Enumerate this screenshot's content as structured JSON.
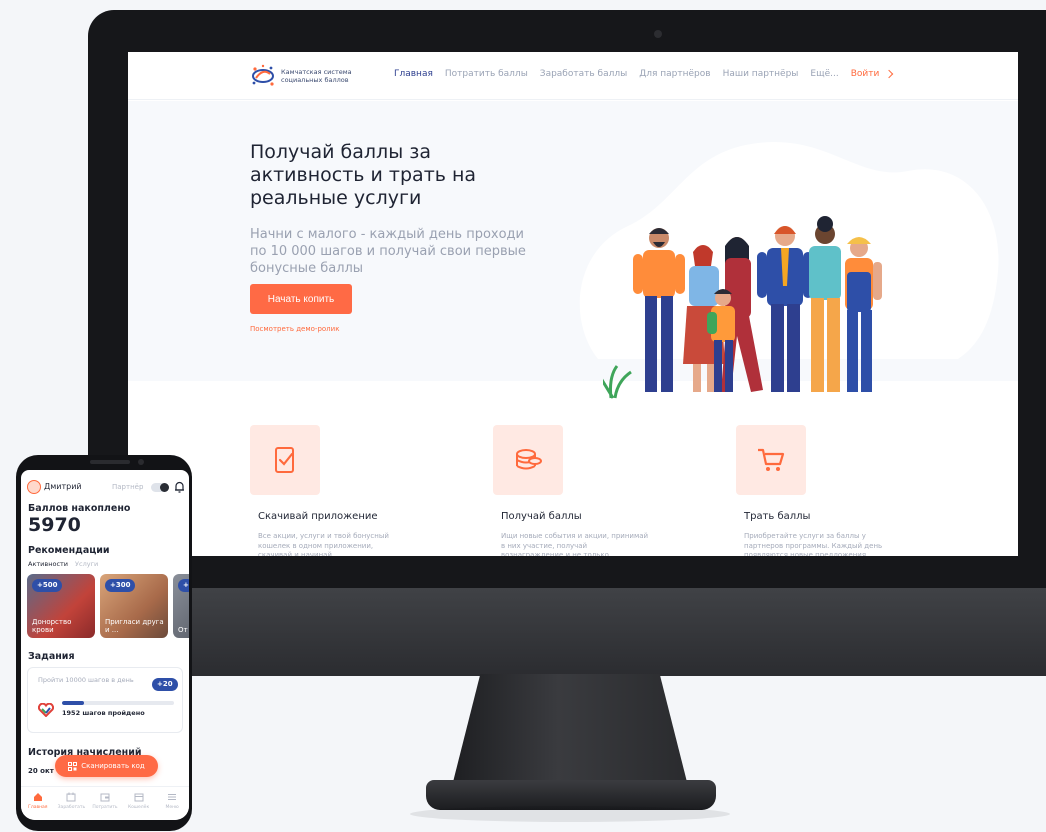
{
  "desktop": {
    "logo_text": "Камчатская система социальных баллов",
    "nav": [
      {
        "label": "Главная"
      },
      {
        "label": "Потратить баллы"
      },
      {
        "label": "Заработать баллы"
      },
      {
        "label": "Для партнёров"
      },
      {
        "label": "Наши партнёры"
      },
      {
        "label": "Ещё..."
      }
    ],
    "login_label": "Войти",
    "hero": {
      "title": "Получай баллы за активность и трать на реальные услуги",
      "subtitle": "Начни с малого - каждый день проходи по 10 000 шагов и получай свои первые бонусные баллы",
      "cta_label": "Начать копить",
      "demo_link": "Посмотреть демо-ролик"
    },
    "features": [
      {
        "icon": "phone-check-icon",
        "title": "Скачивай приложение",
        "desc": "Все акции, услуги и твой бонусный кошелек в одном приложении, скачивай и начинай"
      },
      {
        "icon": "coins-icon",
        "title": "Получай баллы",
        "desc": "Ищи новые события и акции, принимай в них участие, получай вознаграждение и не только"
      },
      {
        "icon": "cart-icon",
        "title": "Трать баллы",
        "desc": "Приобретайте услуги за баллы у партнеров программы. Каждый день появляются новые предложения"
      }
    ],
    "colors": {
      "accent": "#ff6a45",
      "brand": "#2e3f8f",
      "feature_bg": "#ffe9e3"
    }
  },
  "phone": {
    "user_name": "Дмитрий",
    "partner_label": "Партнёр",
    "balance_label": "Баллов накоплено",
    "balance": "5970",
    "recommendations_title": "Рекомендации",
    "tabs": [
      {
        "label": "Активности"
      },
      {
        "label": "Услуги"
      }
    ],
    "cards": [
      {
        "badge": "+500",
        "text": "Донорство крови"
      },
      {
        "badge": "+300",
        "text": "Пригласи друга и ..."
      },
      {
        "badge": "+",
        "text": "От со"
      }
    ],
    "tasks_title": "Задания",
    "task": {
      "title": "Пройти 10000 шагов в день",
      "badge": "+20",
      "progress": 0.195,
      "steps_text": "1952 шагов пройдено"
    },
    "history_title": "История начислений",
    "history_date": "20 окт",
    "scan_label": "Сканировать код",
    "bottom_nav": [
      {
        "label": "Главная",
        "icon": "home-icon"
      },
      {
        "label": "Заработать",
        "icon": "calendar-icon"
      },
      {
        "label": "Потратить",
        "icon": "wallet-icon"
      },
      {
        "label": "Кошелёк",
        "icon": "card-icon"
      },
      {
        "label": "Меню",
        "icon": "menu-icon"
      }
    ]
  }
}
